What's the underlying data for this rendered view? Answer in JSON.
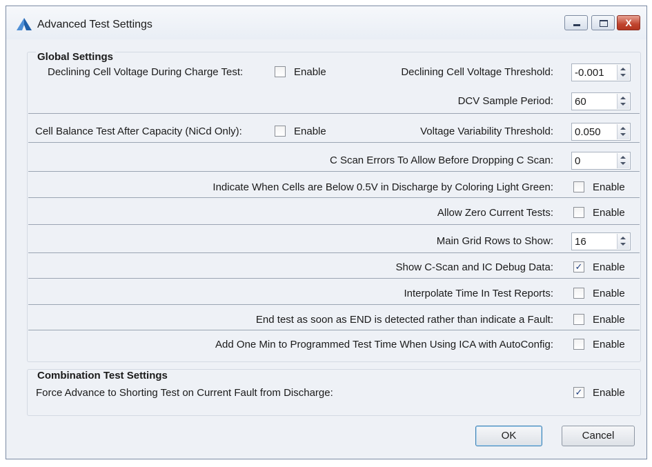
{
  "window": {
    "title": "Advanced Test Settings",
    "close_glyph": "X"
  },
  "global": {
    "title": "Global Settings",
    "rows": [
      {
        "label": "Declining Cell Voltage During Charge Test:",
        "checkbox_label": "Enable",
        "checked": false,
        "right_label": "Declining Cell Voltage Threshold:",
        "value": "-0.001"
      },
      {
        "right_label": "DCV Sample Period:",
        "value": "60"
      },
      {
        "label": "Cell Balance Test After Capacity (NiCd Only):",
        "checkbox_label": "Enable",
        "checked": false,
        "right_label": "Voltage Variability Threshold:",
        "value": "0.050"
      },
      {
        "right_label": "C Scan Errors To Allow Before Dropping C Scan:",
        "value": "0"
      },
      {
        "right_label": "Indicate When Cells are Below 0.5V in Discharge by Coloring Light Green:",
        "checkbox_label": "Enable",
        "checked": false
      },
      {
        "right_label": "Allow Zero Current Tests:",
        "checkbox_label": "Enable",
        "checked": false
      },
      {
        "right_label": "Main Grid Rows to Show:",
        "value": "16"
      },
      {
        "right_label": "Show C-Scan and IC Debug Data:",
        "checkbox_label": "Enable",
        "checked": true
      },
      {
        "right_label": "Interpolate Time In Test Reports:",
        "checkbox_label": "Enable",
        "checked": false
      },
      {
        "right_label": "End test as soon as END is detected rather than indicate a Fault:",
        "checkbox_label": "Enable",
        "checked": false
      },
      {
        "right_label": "Add One Min to Programmed Test Time When Using ICA with AutoConfig:",
        "checkbox_label": "Enable",
        "checked": false
      }
    ]
  },
  "combo": {
    "title": "Combination Test Settings",
    "label": "Force Advance to Shorting Test on Current Fault from Discharge:",
    "checkbox_label": "Enable",
    "checked": true
  },
  "buttons": {
    "ok": "OK",
    "cancel": "Cancel"
  },
  "check_glyph": "✓",
  "colors": {
    "accent": "#3c7fb1",
    "window_bg": "#eef1f6",
    "close": "#c0452f"
  }
}
